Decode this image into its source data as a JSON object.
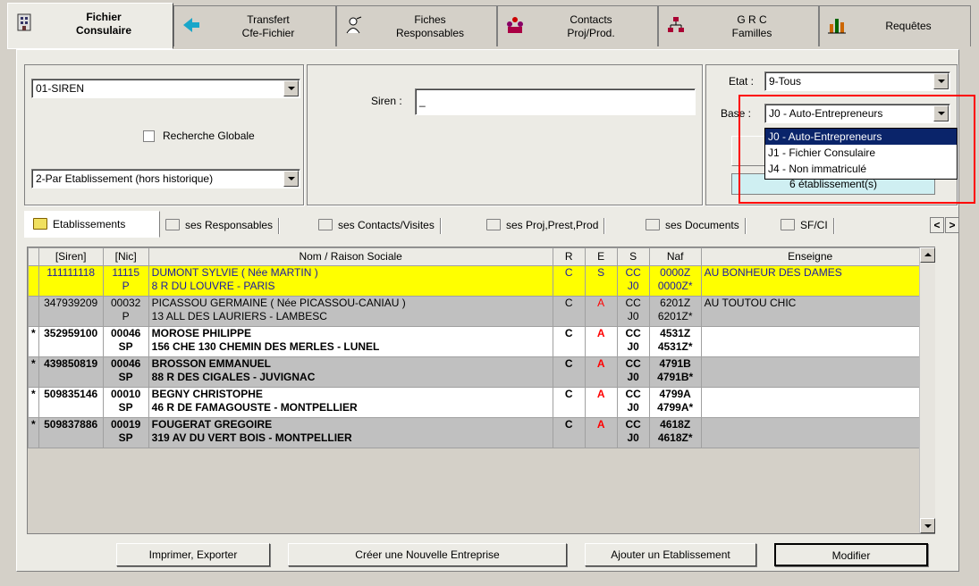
{
  "top_tabs": [
    {
      "label": "Fichier\nConsulaire",
      "icon": "building-icon"
    },
    {
      "label": "Transfert\nCfe-Fichier",
      "icon": "transfer-arrow-icon"
    },
    {
      "label": "Fiches\nResponsables",
      "icon": "person-icon"
    },
    {
      "label": "Contacts\nProj/Prod.",
      "icon": "people-group-icon"
    },
    {
      "label": "G R C\nFamilles",
      "icon": "org-chart-icon"
    },
    {
      "label": "Requêtes",
      "icon": "bar-chart-icon"
    }
  ],
  "search": {
    "criteria_combo": "01-SIREN",
    "global_search_label": "Recherche Globale",
    "mode_combo": "2-Par Etablissement (hors historique)",
    "siren_label": "Siren :",
    "siren_value": "_",
    "etat_label": "Etat :",
    "etat_value": "9-Tous",
    "base_label": "Base :",
    "base_value": "J0 - Auto-Entrepreneurs",
    "base_options": [
      "J0 - Auto-Entrepreneurs",
      "J1 - Fichier Consulaire",
      "J4 - Non immatriculé"
    ],
    "count_text": "6 établissement(s)"
  },
  "inner_tabs": [
    "Etablissements",
    "ses Responsables",
    "ses Contacts/Visites",
    "ses Proj,Prest,Prod",
    "ses Documents",
    "SF/CI"
  ],
  "table": {
    "headers": [
      "[Siren]",
      "[Nic]",
      "Nom / Raison Sociale",
      "R",
      "E",
      "S",
      "Naf",
      "Enseigne"
    ],
    "rows": [
      {
        "mark": "",
        "siren": "111111118",
        "nic1": "11115",
        "nic2": "P",
        "name1": "DUMONT SYLVIE ( Née MARTIN )",
        "name2": "8 R DU LOUVRE - PARIS",
        "r": "C",
        "e": "S",
        "s1": "CC",
        "s2": "J0",
        "naf1": "0000Z",
        "naf2": "0000Z*",
        "enseigne": "AU BONHEUR DES DAMES"
      },
      {
        "mark": "",
        "siren": "347939209",
        "nic1": "00032",
        "nic2": "P",
        "name1": "PICASSOU GERMAINE ( Née PICASSOU-CANIAU )",
        "name2": "13 ALL DES LAURIERS - LAMBESC",
        "r": "C",
        "e": "A",
        "s1": "CC",
        "s2": "J0",
        "naf1": "6201Z",
        "naf2": "6201Z*",
        "enseigne": "AU TOUTOU CHIC"
      },
      {
        "mark": "*",
        "siren": "352959100",
        "nic1": "00046",
        "nic2": "SP",
        "name1": "MOROSE PHILIPPE",
        "name2": "156 CHE 130 CHEMIN DES MERLES - LUNEL",
        "r": "C",
        "e": "A",
        "s1": "CC",
        "s2": "J0",
        "naf1": "4531Z",
        "naf2": "4531Z*",
        "enseigne": ""
      },
      {
        "mark": "*",
        "siren": "439850819",
        "nic1": "00046",
        "nic2": "SP",
        "name1": "BROSSON EMMANUEL",
        "name2": "88 R DES CIGALES - JUVIGNAC",
        "r": "C",
        "e": "A",
        "s1": "CC",
        "s2": "J0",
        "naf1": "4791B",
        "naf2": "4791B*",
        "enseigne": ""
      },
      {
        "mark": "*",
        "siren": "509835146",
        "nic1": "00010",
        "nic2": "SP",
        "name1": "BEGNY CHRISTOPHE",
        "name2": "46 R DE FAMAGOUSTE - MONTPELLIER",
        "r": "C",
        "e": "A",
        "s1": "CC",
        "s2": "J0",
        "naf1": "4799A",
        "naf2": "4799A*",
        "enseigne": ""
      },
      {
        "mark": "*",
        "siren": "509837886",
        "nic1": "00019",
        "nic2": "SP",
        "name1": "FOUGERAT GREGOIRE",
        "name2": "319 AV DU VERT BOIS - MONTPELLIER",
        "r": "C",
        "e": "A",
        "s1": "CC",
        "s2": "J0",
        "naf1": "4618Z",
        "naf2": "4618Z*",
        "enseigne": ""
      }
    ]
  },
  "buttons": {
    "print": "Imprimer, Exporter",
    "create": "Créer une Nouvelle Entreprise",
    "add": "Ajouter un Etablissement",
    "modify": "Modifier"
  },
  "colors": {
    "highlight_box": "#ff0000",
    "selected_row": "#ffff00",
    "dropdown_selection": "#0a246a"
  }
}
